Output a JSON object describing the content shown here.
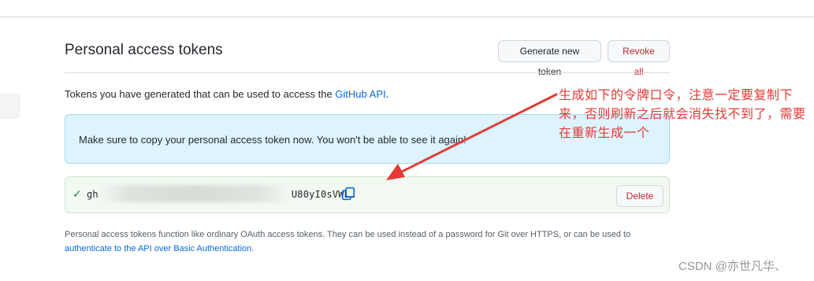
{
  "section": {
    "title": "Personal access tokens",
    "generate_button": "Generate new token",
    "revoke_button": "Revoke all"
  },
  "description": {
    "text": "Tokens you have generated that can be used to access the ",
    "link": "GitHub API",
    "suffix": "."
  },
  "flash": {
    "text": "Make sure to copy your personal access token now. You won't be able to see it again!"
  },
  "token": {
    "visible_prefix": "gh",
    "visible_suffix": "U80yI0sVWEI",
    "delete_button": "Delete",
    "status_icon": "check-icon",
    "copy_icon": "copy-icon"
  },
  "footer": {
    "text": "Personal access tokens function like ordinary OAuth access tokens. They can be used instead of a password for Git over HTTPS, or can be used to",
    "link": "authenticate to the API over Basic Authentication",
    "suffix": "."
  },
  "annotation": {
    "text": "生成如下的令牌口令，注意一定要复制下来，否则刷新之后就会消失找不到了，需要在重新生成一个",
    "color": "#e53935"
  },
  "watermark": "CSDN @亦世凡华、",
  "colors": {
    "link": "#0969da",
    "danger": "#cf222e",
    "success": "#1a7f37",
    "flash_bg": "#ddf4ff"
  }
}
